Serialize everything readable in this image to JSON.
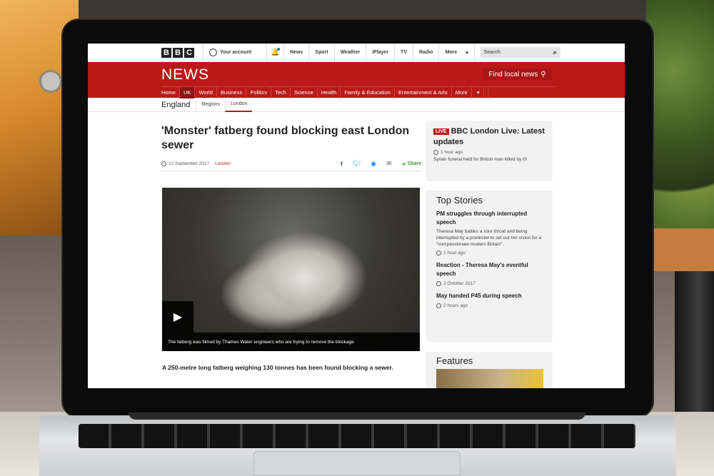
{
  "topbar": {
    "logo_letters": [
      "B",
      "B",
      "C"
    ],
    "account": "Your account",
    "nav": [
      "News",
      "Sport",
      "Weather",
      "iPlayer",
      "TV",
      "Radio",
      "More"
    ],
    "search_placeholder": "Search"
  },
  "header": {
    "news_logo": "NEWS",
    "find_local": "Find local news"
  },
  "mainnav": {
    "items": [
      "Home",
      "UK",
      "World",
      "Business",
      "Politics",
      "Tech",
      "Science",
      "Health",
      "Family & Education",
      "Entertainment & Arts",
      "More"
    ],
    "active_index": 1
  },
  "subnav": {
    "title": "England",
    "items": [
      "Regions",
      "London"
    ],
    "active": "London"
  },
  "article": {
    "headline": "'Monster' fatberg found blocking east London sewer",
    "date": "12 September 2017",
    "location": "London",
    "share_label": "Share",
    "video_caption": "The fatberg was filmed by Thames Water engineers who are trying to remove the blockage",
    "lead": "A 250-metre long fatberg weighing 130 tonnes has been found blocking a sewer."
  },
  "live": {
    "badge": "LIVE",
    "title": "BBC London Live: Latest updates",
    "time": "1 hour ago",
    "line": "Syrian funeral held for British man killed by IS"
  },
  "top_stories": {
    "title": "Top Stories",
    "stories": [
      {
        "title": "PM struggles through interrupted speech",
        "summary": "Theresa May battles a sore throat and being interrupted by a prankster to set out her vision for a \"compassionate modern Britain\".",
        "time": "1 hour ago"
      },
      {
        "title": "Reaction - Theresa May's eventful speech",
        "time": "2 October 2017"
      },
      {
        "title": "May handed P45 during speech",
        "time": "2 hours ago"
      }
    ]
  },
  "features": {
    "title": "Features"
  },
  "colors": {
    "bbc_red": "#bb1919",
    "link_blue": "#1380a1"
  }
}
